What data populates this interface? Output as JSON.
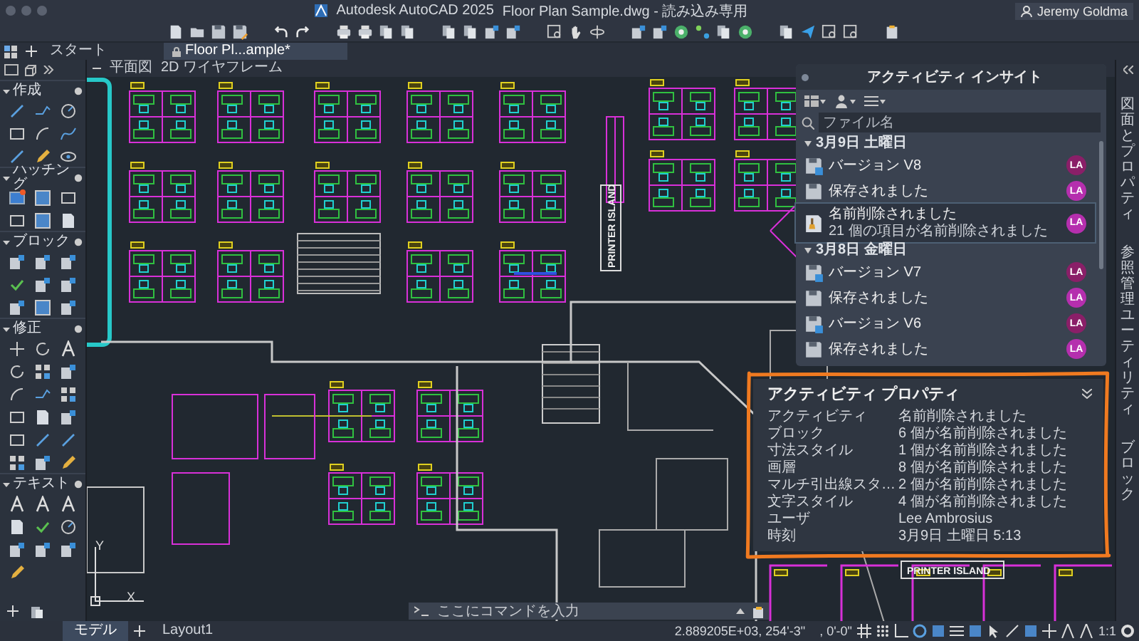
{
  "window": {
    "title": "Autodesk AutoCAD 2025",
    "document": "Floor Plan Sample.dwg - 読み込み専用",
    "user": "Jeremy Goldma"
  },
  "tabs": [
    {
      "label": "スタート",
      "selected": false
    },
    {
      "label": "Floor Pl...ample*",
      "selected": true
    }
  ],
  "viewport_controls": [
    "平面図",
    "2D ワイヤフレーム"
  ],
  "palette": {
    "sections": [
      {
        "title": "作成",
        "expanded": true
      },
      {
        "title": "ハッチング",
        "expanded": true
      },
      {
        "title": "ブロック",
        "expanded": true
      },
      {
        "title": "修正",
        "expanded": true
      },
      {
        "title": "テキスト",
        "expanded": true
      }
    ]
  },
  "drawing": {
    "labels": [
      "PRINTER ISLAND",
      "PRINTER ISLAND"
    ],
    "ucs_axes": [
      "Y",
      "X"
    ]
  },
  "activity_insights": {
    "title": "アクティビティ インサイト",
    "search": {
      "placeholder": "ファイル名"
    },
    "groups": [
      {
        "date": "3月9日 土曜日",
        "expanded": true,
        "items": [
          {
            "kind": "version",
            "label": "バージョン V8",
            "user": "LA",
            "color": "#8a1f68",
            "selected": false
          },
          {
            "kind": "saved",
            "label": "保存されました",
            "user": "LA",
            "color": "#b52fae",
            "selected": false
          },
          {
            "kind": "purge",
            "label": "名前削除されました",
            "detail": "21 個の項目が名前削除されました",
            "user": "LA",
            "color": "#b52fae",
            "selected": true
          }
        ]
      },
      {
        "date": "3月8日 金曜日",
        "expanded": true,
        "items": [
          {
            "kind": "version",
            "label": "バージョン V7",
            "user": "LA",
            "color": "#8a1f68",
            "selected": false
          },
          {
            "kind": "saved",
            "label": "保存されました",
            "user": "LA",
            "color": "#b52fae",
            "selected": false
          },
          {
            "kind": "version",
            "label": "バージョン V6",
            "user": "LA",
            "color": "#8a1f68",
            "selected": false
          },
          {
            "kind": "saved",
            "label": "保存されました",
            "user": "LA",
            "color": "#b52fae",
            "selected": false
          }
        ]
      }
    ]
  },
  "activity_properties": {
    "title": "アクティビティ プロパティ",
    "rows": [
      {
        "label": "アクティビティ",
        "value": "名前削除されました"
      },
      {
        "label": "ブロック",
        "value": "6 個が名前削除されました"
      },
      {
        "label": "寸法スタイル",
        "value": "1 個が名前削除されました"
      },
      {
        "label": "画層",
        "value": "8 個が名前削除されました"
      },
      {
        "label": "マルチ引出線スタ…",
        "value": "2 個が名前削除されました"
      },
      {
        "label": "文字スタイル",
        "value": "4 個が名前削除されました"
      },
      {
        "label": "ユーザ",
        "value": "Lee Ambrosius"
      },
      {
        "label": "時刻",
        "value": "3月9日 土曜日 5:13"
      }
    ]
  },
  "side_tabs": [
    "図面とプロパティ",
    "参照管理ユーティリティ",
    "ブロック"
  ],
  "command_line": {
    "placeholder": "ここにコマンドを入力"
  },
  "layout_tabs": [
    {
      "label": "モデル",
      "selected": true
    },
    {
      "label": "Layout1",
      "selected": false
    }
  ],
  "status_bar": {
    "coordinates": "2.889205E+03, 254'-3\"",
    "elevation": ", 0'-0\"",
    "scale": "1:1"
  }
}
